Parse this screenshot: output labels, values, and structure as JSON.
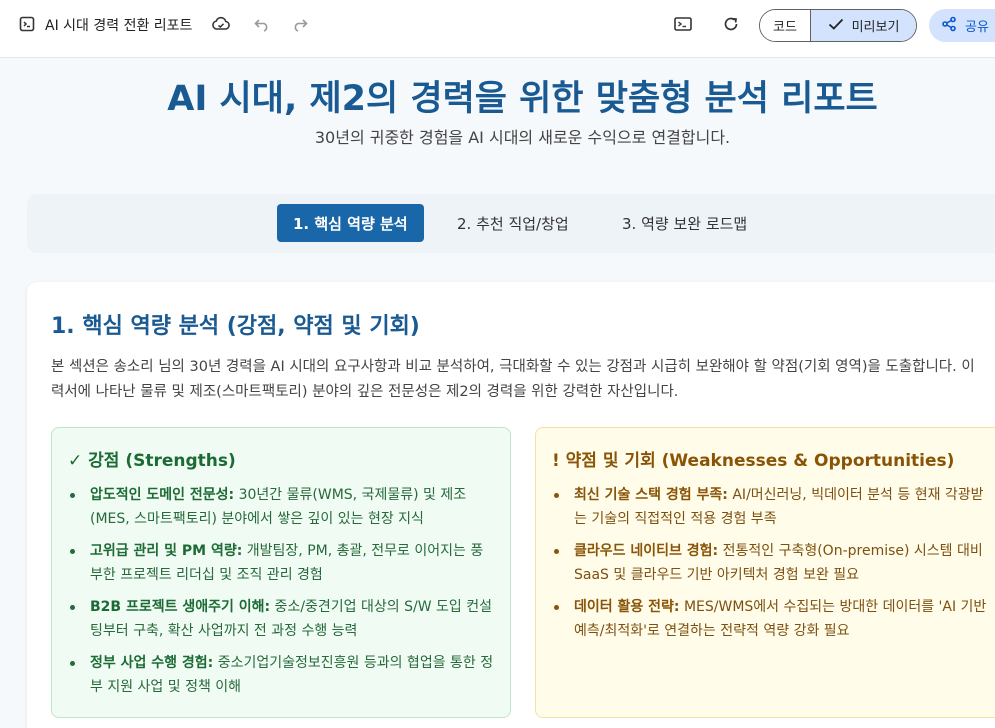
{
  "toolbar": {
    "title": "AI 시대 경력 전환 리포트",
    "code_label": "코드",
    "preview_label": "미리보기",
    "share_label": "공유"
  },
  "header": {
    "title": "AI 시대, 제2의 경력을 위한 맞춤형 분석 리포트",
    "subtitle": "30년의 귀중한 경험을 AI 시대의 새로운 수익으로 연결합니다."
  },
  "tabs": [
    {
      "label": "1. 핵심 역량 분석"
    },
    {
      "label": "2. 추천 직업/창업"
    },
    {
      "label": "3. 역량 보완 로드맵"
    }
  ],
  "section": {
    "title": "1. 핵심 역량 분석 (강점, 약점 및 기회)",
    "intro": "본 섹션은 송소리 님의 30년 경력을 AI 시대의 요구사항과 비교 분석하여, 극대화할 수 있는 강점과 시급히 보완해야 할 약점(기회 영역)을 도출합니다. 이력서에 나타난 물류 및 제조(스마트팩토리) 분야의 깊은 전문성은 제2의 경력을 위한 강력한 자산입니다."
  },
  "strengths": {
    "title": "✓ 강점 (Strengths)",
    "items": [
      {
        "label": "압도적인 도메인 전문성:",
        "text": " 30년간 물류(WMS, 국제물류) 및 제조(MES, 스마트팩토리) 분야에서 쌓은 깊이 있는 현장 지식"
      },
      {
        "label": "고위급 관리 및 PM 역량:",
        "text": " 개발팀장, PM, 총괄, 전무로 이어지는 풍부한 프로젝트 리더십 및 조직 관리 경험"
      },
      {
        "label": "B2B 프로젝트 생애주기 이해:",
        "text": " 중소/중견기업 대상의 S/W 도입 컨설팅부터 구축, 확산 사업까지 전 과정 수행 능력"
      },
      {
        "label": "정부 사업 수행 경험:",
        "text": " 중소기업기술정보진흥원 등과의 협업을 통한 정부 지원 사업 및 정책 이해"
      }
    ]
  },
  "weaknesses": {
    "title": "! 약점 및 기회 (Weaknesses & Opportunities)",
    "items": [
      {
        "label": "최신 기술 스택 경험 부족:",
        "text": " AI/머신러닝, 빅데이터 분석 등 현재 각광받는 기술의 직접적인 적용 경험 부족"
      },
      {
        "label": "클라우드 네이티브 경험:",
        "text": " 전통적인 구축형(On-premise) 시스템 대비 SaaS 및 클라우드 기반 아키텍처 경험 보완 필요"
      },
      {
        "label": "데이터 활용 전략:",
        "text": " MES/WMS에서 수집되는 방대한 데이터를 'AI 기반 예측/최적화'로 연결하는 전략적 역량 강화 필요"
      }
    ]
  },
  "colors": {
    "primary": "#1966a8",
    "title_blue": "#1a5a93",
    "strength_bg": "#f0fbf3",
    "strength_text": "#27693c",
    "weak_bg": "#fffcea",
    "weak_text": "#8a5406"
  },
  "icons": [
    "doc-icon",
    "cloud-icon",
    "undo-icon",
    "redo-icon",
    "terminal-icon",
    "refresh-icon",
    "check-icon",
    "share-icon"
  ]
}
